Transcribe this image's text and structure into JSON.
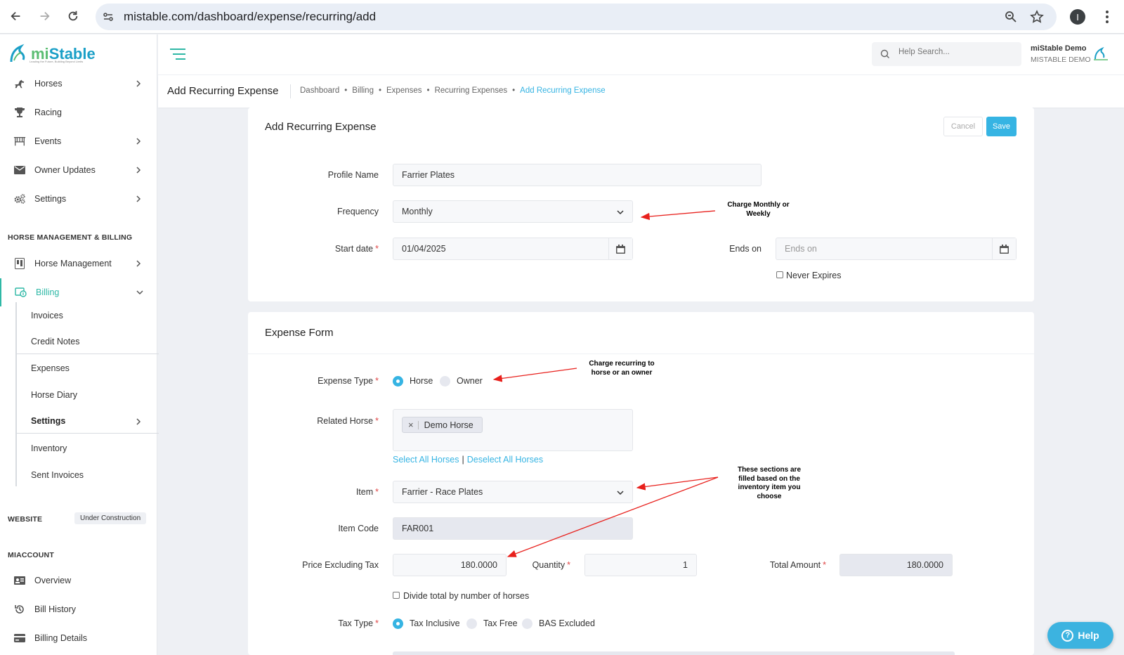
{
  "browser": {
    "url": "mistable.com/dashboard/expense/recurring/add",
    "profile_initial": "I"
  },
  "logo": {
    "name_part1": "mi",
    "name_part2": "Stable",
    "tagline": "Leading the Future, Building Beyond Limits"
  },
  "sidebar": {
    "items": [
      {
        "label": "Horses",
        "icon": "horse-icon"
      },
      {
        "label": "Racing",
        "icon": "trophy-icon"
      },
      {
        "label": "Events",
        "icon": "gate-icon"
      },
      {
        "label": "Owner Updates",
        "icon": "envelope-icon"
      },
      {
        "label": "Settings",
        "icon": "gears-icon"
      }
    ],
    "section_horse_mgmt": "HORSE MANAGEMENT & BILLING",
    "horse_management": "Horse Management",
    "billing": "Billing",
    "billing_sub": [
      "Invoices",
      "Credit Notes",
      "Expenses",
      "Horse Diary",
      "Settings",
      "Inventory",
      "Sent Invoices"
    ],
    "section_website": "WEBSITE",
    "website_badge": "Under Construction",
    "section_account": "MIACCOUNT",
    "account_items": [
      "Overview",
      "Bill History",
      "Billing Details"
    ]
  },
  "header": {
    "search_placeholder": "Help Search...",
    "user_name": "miStable Demo",
    "user_org": "MISTABLE DEMO"
  },
  "page": {
    "title": "Add Recurring Expense",
    "breadcrumb": [
      "Dashboard",
      "Billing",
      "Expenses",
      "Recurring Expenses",
      "Add Recurring Expense"
    ]
  },
  "recurring": {
    "title": "Add Recurring Expense",
    "cancel": "Cancel",
    "save": "Save",
    "profile_name_label": "Profile Name",
    "profile_name_value": "Farrier Plates",
    "frequency_label": "Frequency",
    "frequency_value": "Monthly",
    "start_date_label": "Start date",
    "start_date_value": "01/04/2025",
    "ends_on_label": "Ends on",
    "ends_on_placeholder": "Ends on",
    "never_expires": "Never Expires"
  },
  "expense": {
    "title": "Expense Form",
    "type_label": "Expense Type",
    "type_options": [
      "Horse",
      "Owner"
    ],
    "related_horse_label": "Related Horse",
    "related_horse_tag": "Demo Horse",
    "select_all": "Select All Horses",
    "pipe": "|",
    "deselect_all": "Deselect All Horses",
    "item_label": "Item",
    "item_value": "Farrier - Race Plates",
    "item_code_label": "Item Code",
    "item_code_value": "FAR001",
    "price_label": "Price Excluding Tax",
    "price_value": "180.0000",
    "quantity_label": "Quantity",
    "quantity_value": "1",
    "total_label": "Total Amount",
    "total_value": "180.0000",
    "divide_label": "Divide total by number of horses",
    "tax_label": "Tax Type",
    "tax_options": [
      "Tax Inclusive",
      "Tax Free",
      "BAS Excluded"
    ]
  },
  "annotations": {
    "frequency_note": "Charge Monthly or Weekly",
    "type_note": "Charge recurring to horse or an owner",
    "item_note": "These sections are filled based on the inventory item you choose"
  },
  "help_button": "Help",
  "colors": {
    "accent": "#36b4e3",
    "active_nav": "#2fb8a6",
    "required": "#e04848",
    "arrow": "#e8201c"
  }
}
